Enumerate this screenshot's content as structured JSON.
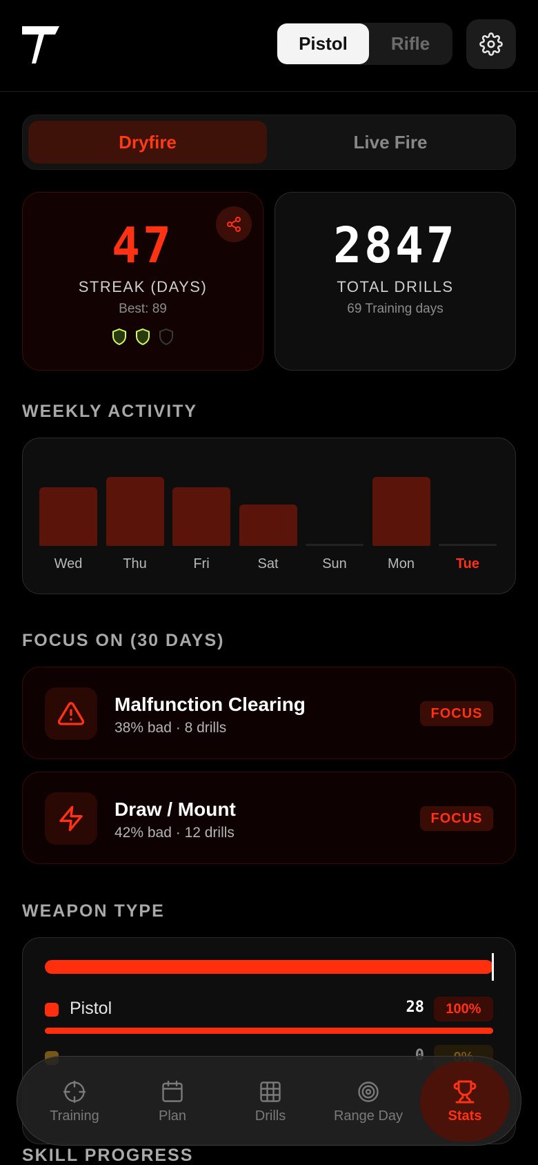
{
  "header": {
    "weapon_toggle": {
      "active": "Pistol",
      "inactive": "Rifle"
    }
  },
  "mode_toggle": {
    "active": "Dryfire",
    "inactive": "Live Fire"
  },
  "streak_card": {
    "value": "47",
    "label": "STREAK (DAYS)",
    "best": "Best: 89",
    "shields_earned": 2,
    "shields_total": 3
  },
  "drills_card": {
    "value": "2847",
    "label": "TOTAL DRILLS",
    "sub": "69 Training days"
  },
  "weekly": {
    "title": "WEEKLY ACTIVITY",
    "days": [
      {
        "label": "Wed",
        "level": 0.85
      },
      {
        "label": "Thu",
        "level": 1.0
      },
      {
        "label": "Fri",
        "level": 0.85
      },
      {
        "label": "Sat",
        "level": 0.6
      },
      {
        "label": "Sun",
        "level": 0
      },
      {
        "label": "Mon",
        "level": 1.0
      },
      {
        "label": "Tue",
        "level": 0
      }
    ],
    "today": "Tue"
  },
  "focus": {
    "title": "FOCUS ON (30 DAYS)",
    "items": [
      {
        "title": "Malfunction Clearing",
        "sub": "38% bad · 8 drills",
        "badge": "FOCUS",
        "icon": "warning-triangle-icon"
      },
      {
        "title": "Draw / Mount",
        "sub": "42% bad · 12 drills",
        "badge": "FOCUS",
        "icon": "lightning-bolt-icon"
      }
    ]
  },
  "weapon_type": {
    "title": "WEAPON TYPE",
    "rows": [
      {
        "name": "Pistol",
        "count": "28",
        "pct": "100%",
        "fraction": 1.0
      },
      {
        "name": "",
        "count": "0",
        "pct": "0%",
        "fraction": 0
      }
    ]
  },
  "nav": {
    "items": [
      {
        "label": "Training",
        "icon": "crosshair-icon"
      },
      {
        "label": "Plan",
        "icon": "calendar-icon"
      },
      {
        "label": "Drills",
        "icon": "grid-icon"
      },
      {
        "label": "Range Day",
        "icon": "target-icon"
      },
      {
        "label": "Stats",
        "icon": "trophy-icon"
      }
    ],
    "active": "Stats"
  },
  "skill_progress": {
    "title": "SKILL PROGRESS"
  },
  "colors": {
    "accent": "#ff3214",
    "bar": "#5b1409",
    "background": "#000000",
    "shield_earned": "#d7ff5a"
  }
}
